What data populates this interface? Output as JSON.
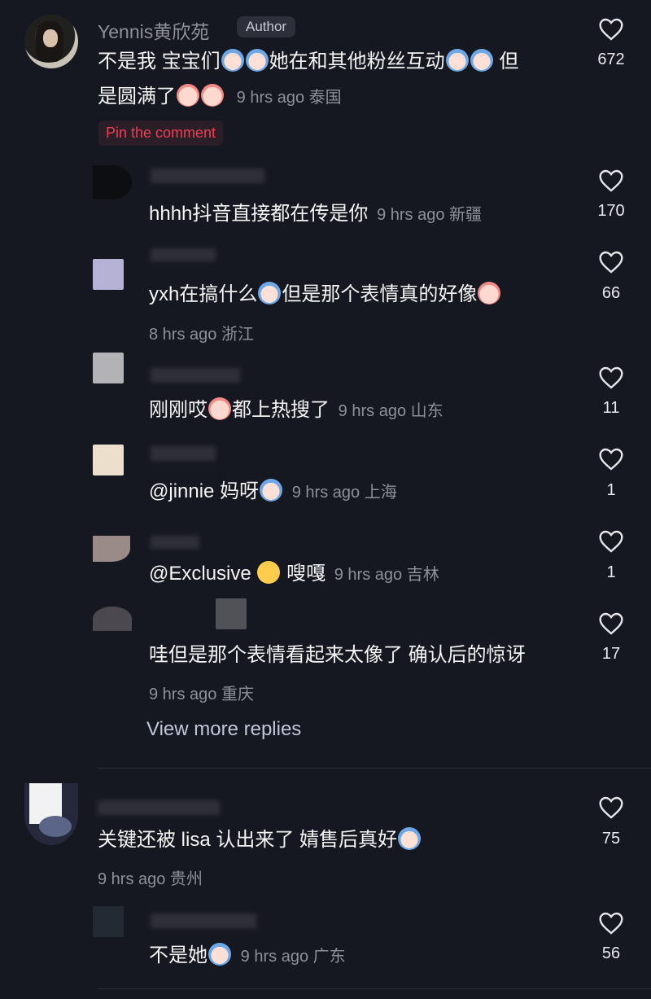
{
  "top_comment": {
    "username": "Yennis黄欣苑",
    "badge": "Author",
    "text_line1": "不是我 宝宝们",
    "text_mid": "她在和其他粉丝互动",
    "text_end": "但",
    "text_line2": "是圆满了",
    "meta": "9 hrs ago 泰国",
    "likes": "672",
    "pin_label": "Pin the comment"
  },
  "replies": [
    {
      "text": "hhhh抖音直接都在传是你",
      "meta": "9 hrs ago 新疆",
      "likes": "170"
    },
    {
      "text_a": "yxh在搞什么",
      "text_b": "但是那个表情真的好像",
      "meta": "8 hrs ago 浙江",
      "likes": "66"
    },
    {
      "text_a": "刚刚哎",
      "text_b": "都上热搜了",
      "meta": "9 hrs ago 山东",
      "likes": "11"
    },
    {
      "text": "@jinnie 妈呀",
      "meta": "9 hrs ago 上海",
      "likes": "1"
    },
    {
      "text_a": "@Exclusive",
      "text_b": "嗖嘎",
      "meta": "9 hrs ago 吉林",
      "likes": "1"
    },
    {
      "text": "哇但是那个表情看起来太像了 确认后的惊讶",
      "meta": "9 hrs ago 重庆",
      "likes": "17"
    }
  ],
  "view_more": "View more replies",
  "comment2": {
    "text": "关键还被 lisa 认出来了 婧售后真好",
    "meta": "9 hrs ago 贵州",
    "likes": "75"
  },
  "comment3": {
    "text": "不是她",
    "meta": "9 hrs ago 广东",
    "likes": "56"
  },
  "colors": {
    "bg": "#161821",
    "accent": "#f03d55",
    "muted": "#8e8f99"
  },
  "icons": {
    "like": "heart-outline-icon"
  }
}
